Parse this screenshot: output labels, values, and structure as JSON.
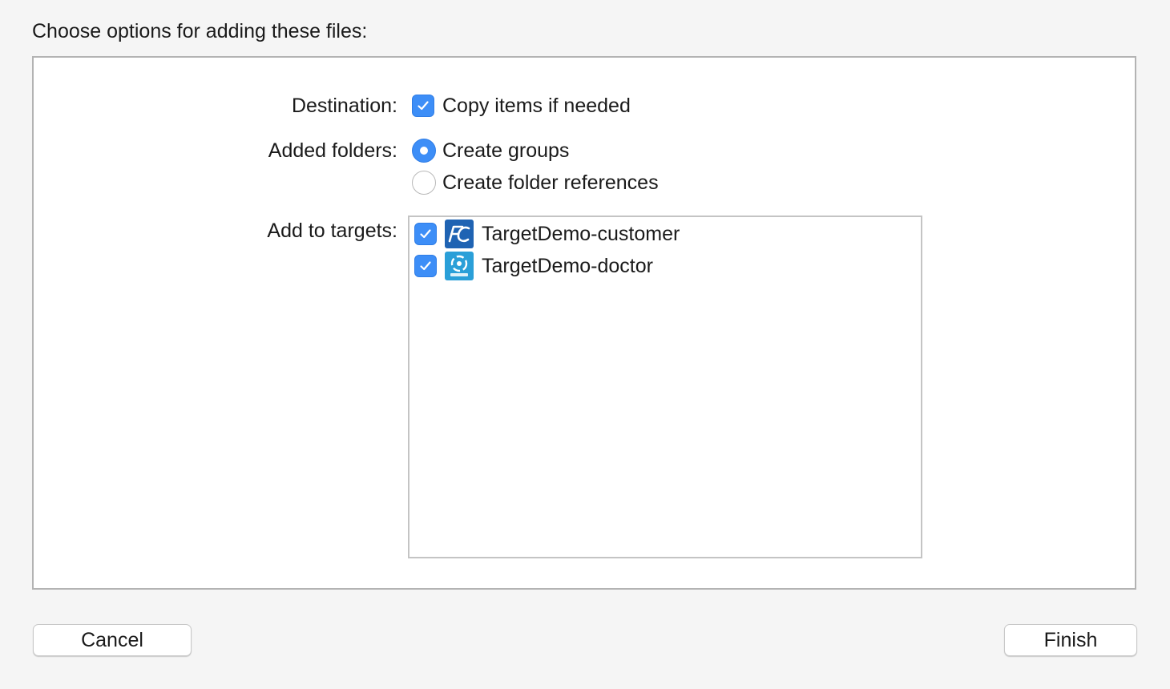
{
  "dialog": {
    "title": "Choose options for adding these files:"
  },
  "destination": {
    "label": "Destination:",
    "copy_items": {
      "label": "Copy items if needed",
      "checked": true
    }
  },
  "added_folders": {
    "label": "Added folders:",
    "options": [
      {
        "label": "Create groups",
        "selected": true
      },
      {
        "label": "Create folder references",
        "selected": false
      }
    ]
  },
  "targets": {
    "label": "Add to targets:",
    "items": [
      {
        "name": "TargetDemo-customer",
        "checked": true,
        "icon": "fc-app-icon"
      },
      {
        "name": "TargetDemo-doctor",
        "checked": true,
        "icon": "doctor-app-icon"
      }
    ]
  },
  "buttons": {
    "cancel": "Cancel",
    "finish": "Finish"
  },
  "colors": {
    "accent": "#3d8ef7",
    "panel_border": "#b3b3b3",
    "background": "#f5f5f5"
  }
}
